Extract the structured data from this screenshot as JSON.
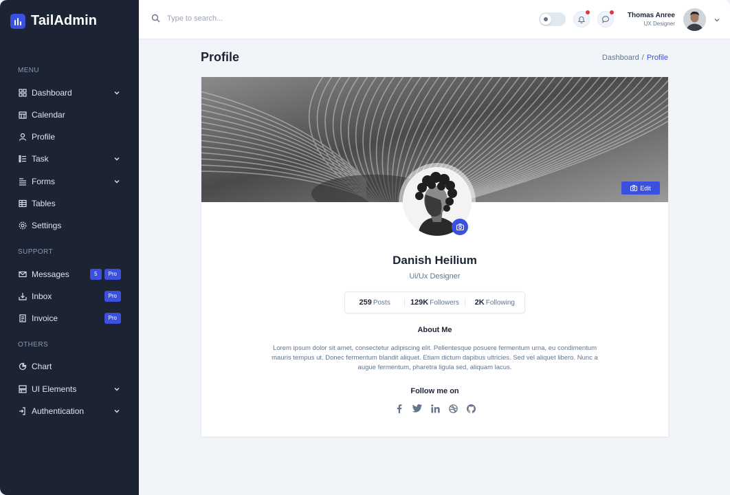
{
  "brand": {
    "name": "TailAdmin",
    "accent": "#3c50e0"
  },
  "sidebar": {
    "groups": [
      {
        "title": "MENU"
      },
      {
        "title": "SUPPORT"
      },
      {
        "title": "OTHERS"
      }
    ],
    "items": [
      {
        "label": "Dashboard",
        "icon": "grid-icon"
      },
      {
        "label": "Calendar",
        "icon": "calendar-icon"
      },
      {
        "label": "Profile",
        "icon": "user-icon"
      },
      {
        "label": "Task",
        "icon": "list-icon"
      },
      {
        "label": "Forms",
        "icon": "form-icon"
      },
      {
        "label": "Tables",
        "icon": "table-icon"
      },
      {
        "label": "Settings",
        "icon": "gear-icon"
      },
      {
        "label": "Messages",
        "icon": "mail-icon",
        "count": "5",
        "badge": "Pro"
      },
      {
        "label": "Inbox",
        "icon": "inbox-icon",
        "badge": "Pro"
      },
      {
        "label": "Invoice",
        "icon": "invoice-icon",
        "badge": "Pro"
      },
      {
        "label": "Chart",
        "icon": "pie-chart-icon"
      },
      {
        "label": "UI Elements",
        "icon": "layout-icon"
      },
      {
        "label": "Authentication",
        "icon": "login-icon"
      }
    ]
  },
  "header": {
    "search_placeholder": "Type to search...",
    "user": {
      "name": "Thomas Anree",
      "role": "UX Designer"
    }
  },
  "page": {
    "title": "Profile",
    "breadcrumb": {
      "parent": "Dashboard",
      "separator": "/",
      "current": "Profile"
    }
  },
  "profile": {
    "edit_label": "Edit",
    "name": "Danish Heilium",
    "role": "Ui/Ux Designer",
    "stats": [
      {
        "value": "259",
        "label": "Posts"
      },
      {
        "value": "129K",
        "label": "Followers"
      },
      {
        "value": "2K",
        "label": "Following"
      }
    ],
    "about_title": "About Me",
    "about_text": "Lorem ipsum dolor sit amet, consectetur adipiscing elit. Pellentesque posuere fermentum urna, eu condimentum mauris tempus ut. Donec fermentum blandit aliquet. Etiam dictum dapibus ultricies. Sed vel aliquet libero. Nunc a augue fermentum, pharetra ligula sed, aliquam lacus.",
    "follow_title": "Follow me on",
    "socials": [
      "facebook-icon",
      "twitter-icon",
      "linkedin-icon",
      "dribbble-icon",
      "github-icon"
    ]
  }
}
